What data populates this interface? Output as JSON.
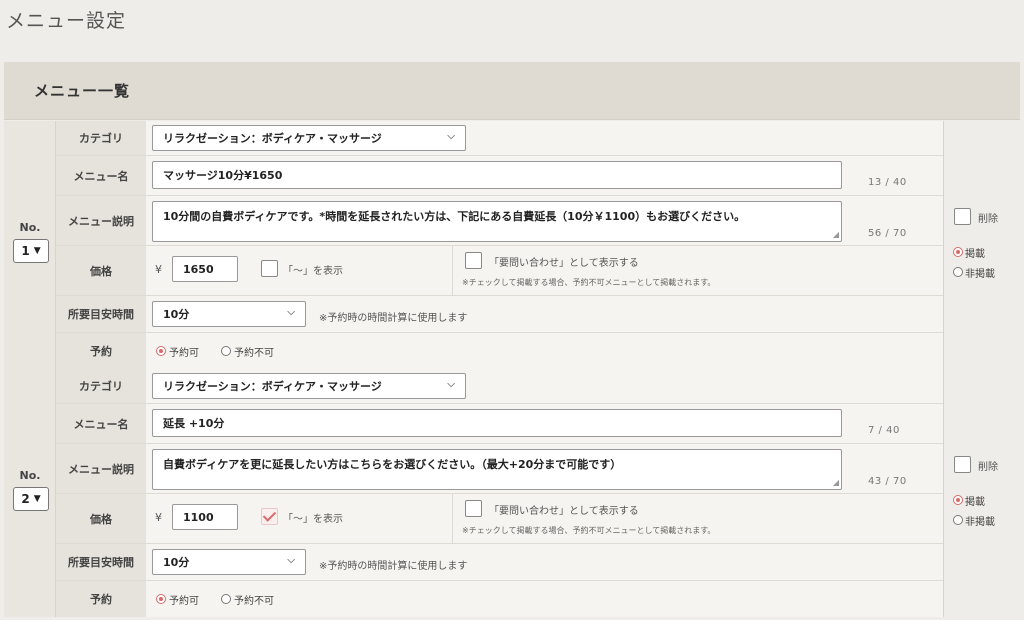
{
  "page": {
    "title": "メニュー設定"
  },
  "panel": {
    "header": "メニュー一覧"
  },
  "labels": {
    "no": "No.",
    "category": "カテゴリ",
    "menu_name": "メニュー名",
    "menu_desc": "メニュー説明",
    "price": "価格",
    "duration": "所要目安時間",
    "reservation": "予約",
    "yen": "¥",
    "show_tilde": "「〜」を表示",
    "show_inquiry": "「要問い合わせ」として表示する",
    "inquiry_note": "※チェックして掲載する場合、予約不可メニューとして掲載されます。",
    "duration_note": "※予約時の時間計算に使用します",
    "reservable": "予約可",
    "not_reservable": "予約不可",
    "delete": "削除",
    "publish": "掲載",
    "unpublish": "非掲載"
  },
  "items": [
    {
      "no": "1",
      "category": "リラクゼーション：ボディケア・マッサージ",
      "menu_name": "マッサージ10分¥1650",
      "name_count": "13 / 40",
      "description": "10分間の自費ボディケアです。*時間を延長されたい方は、下記にある自費延長（10分￥1100）もお選びください。",
      "desc_count": "56 / 70",
      "price": "1650",
      "show_tilde_checked": false,
      "show_inquiry_checked": false,
      "duration": "10分",
      "reservation": "予約可",
      "delete_checked": false,
      "publish_state": "掲載"
    },
    {
      "no": "2",
      "category": "リラクゼーション：ボディケア・マッサージ",
      "menu_name": "延長 +10分",
      "name_count": "7 / 40",
      "description": "自費ボディケアを更に延長したい方はこちらをお選びください。（最大+20分まで可能です）",
      "desc_count": "43 / 70",
      "price": "1100",
      "show_tilde_checked": true,
      "show_inquiry_checked": false,
      "duration": "10分",
      "reservation": "予約可",
      "delete_checked": false,
      "publish_state": "掲載"
    }
  ],
  "colors": {
    "accent": "#d96b6b",
    "header_bg": "#dfdbd3",
    "label_bg": "#e6e3dc"
  }
}
